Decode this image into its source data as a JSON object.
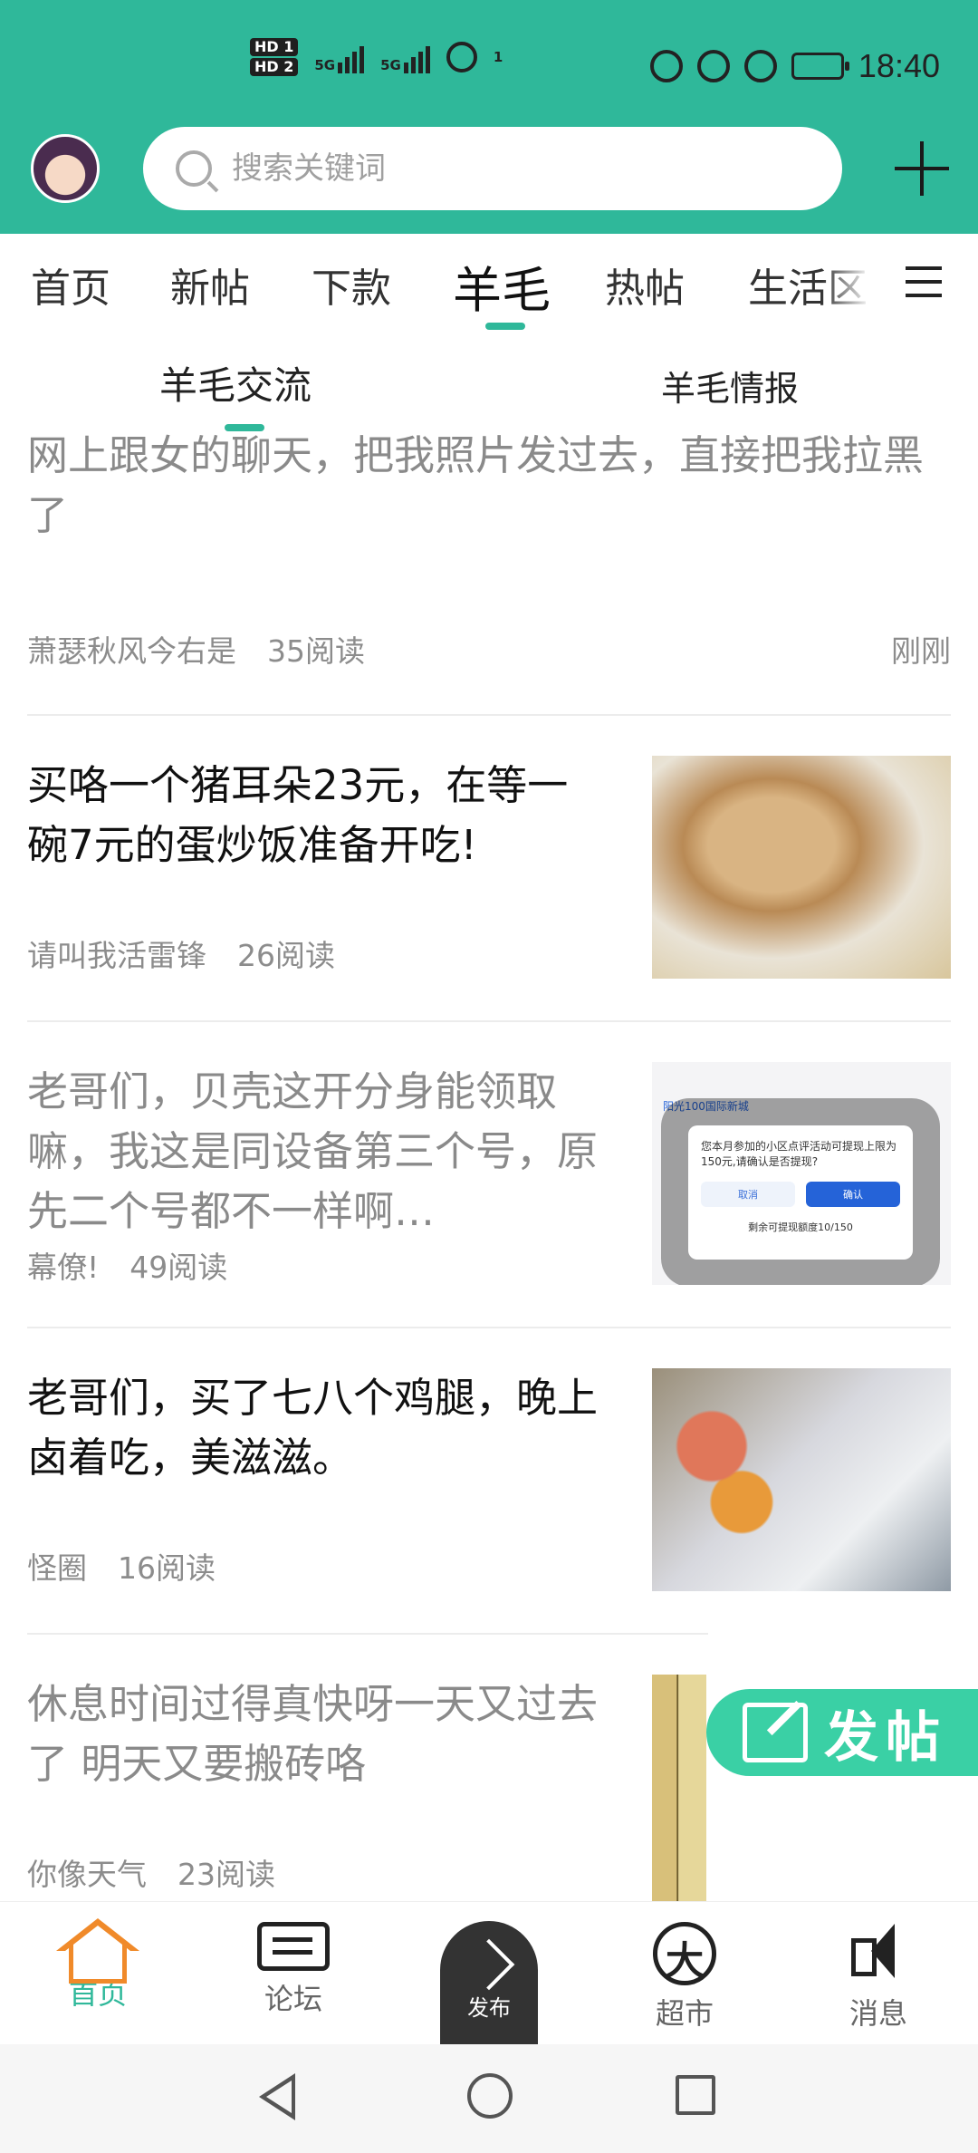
{
  "status_bar": {
    "time": "18:40",
    "hd1": "HD 1",
    "hd2": "HD 2",
    "net1": "5G",
    "net2": "5G",
    "hotspot_count": "1"
  },
  "search": {
    "placeholder": "搜索关键词"
  },
  "tabs": [
    {
      "label": "首页"
    },
    {
      "label": "新帖"
    },
    {
      "label": "下款"
    },
    {
      "label": "羊毛",
      "active": true
    },
    {
      "label": "热帖"
    },
    {
      "label": "生活区"
    }
  ],
  "subtabs": [
    {
      "label": "羊毛交流",
      "active": true
    },
    {
      "label": "羊毛情报"
    }
  ],
  "posts": [
    {
      "title": "网上跟女的聊天，把我照片发过去，直接把我拉黑了",
      "author": "萧瑟秋风今右是",
      "reads": "35阅读",
      "time": "刚刚",
      "read": true
    },
    {
      "title": "买咯一个猪耳朵23元，在等一碗7元的蛋炒饭准备开吃!",
      "author": "请叫我活雷锋",
      "reads": "26阅读",
      "read": false
    },
    {
      "title": "老哥们，贝壳这开分身能领取嘛，我这是同设备第三个号，原先二个号都不一样啊…",
      "author": "幕僚!",
      "reads": "49阅读",
      "read": true,
      "dialog": {
        "text": "您本月参加的小区点评活动可提现上限为150元,请确认是否提现?",
        "cancel": "取消",
        "ok": "确认",
        "foot": "剩余可提现额度10/150",
        "bg_title": "阳光100国际新城"
      }
    },
    {
      "title": "老哥们，买了七八个鸡腿，晚上卤着吃，美滋滋。",
      "author": "怪圈",
      "reads": "16阅读",
      "read": false
    },
    {
      "title": "休息时间过得真快呀一天又过去了 明天又要搬砖咯",
      "author": "你像天气",
      "reads": "23阅读",
      "read": true
    }
  ],
  "fab": {
    "label": "发帖"
  },
  "bottom_nav": [
    {
      "label": "首页",
      "active": true
    },
    {
      "label": "论坛"
    },
    {
      "label": "发布"
    },
    {
      "label": "超市"
    },
    {
      "label": "消息"
    }
  ],
  "colors": {
    "brand": "#2fb89a",
    "fab": "#3ad0a5",
    "home_icon": "#f08a2a"
  }
}
